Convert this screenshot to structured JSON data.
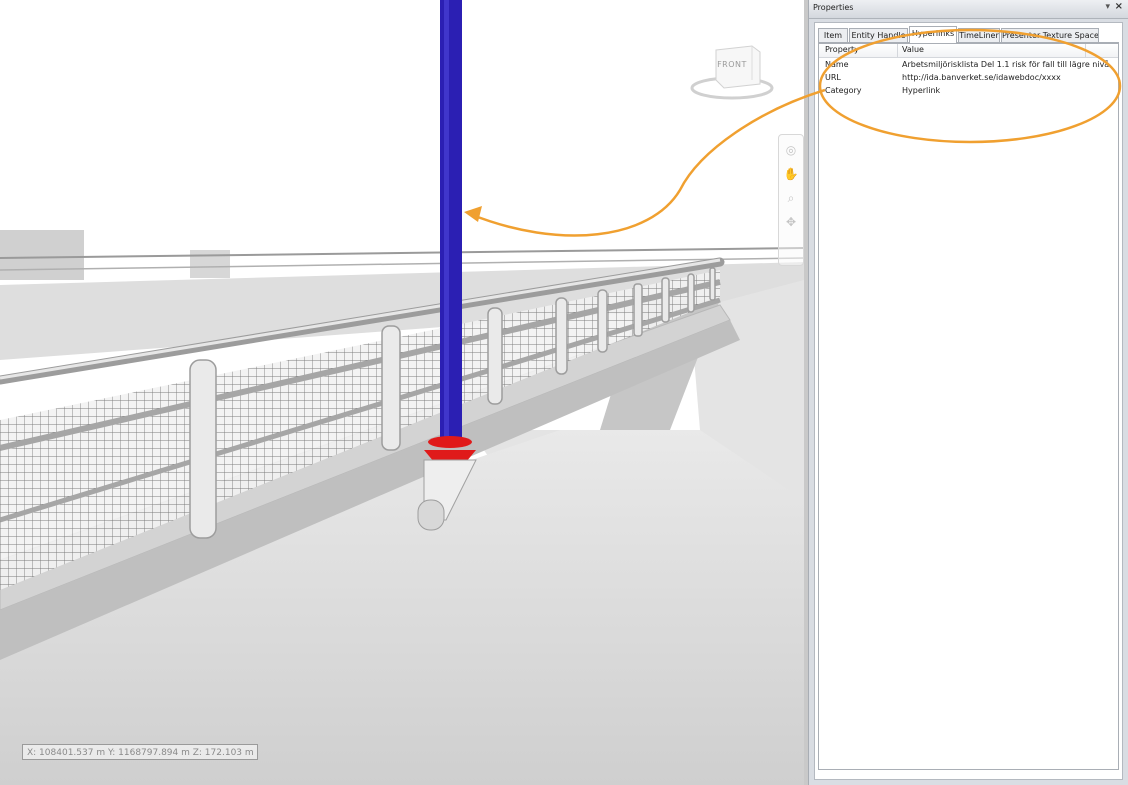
{
  "viewport": {
    "coordinates": "X: 108401.537 m  Y: 1168797.894 m  Z: 172.103 m",
    "viewcube_label": "FRONT",
    "nav_icons": [
      "orbit-icon",
      "pan-hand-icon",
      "zoom-icon",
      "walk-icon"
    ]
  },
  "panel": {
    "title": "Properties",
    "pin_icon": "pin-icon",
    "close_icon": "close-icon",
    "tabs": [
      {
        "label": "Item"
      },
      {
        "label": "Entity Handle"
      },
      {
        "label": "Hyperlinks"
      },
      {
        "label": "TimeLiner"
      },
      {
        "label": "Presenter Texture Space"
      }
    ],
    "active_tab": "Hyperlinks",
    "columns": [
      "Property",
      "Value"
    ],
    "rows": [
      {
        "property": "Name",
        "value": "Arbetsmiljörisklista Del 1.1 risk för fall till lägre nivå"
      },
      {
        "property": "URL",
        "value": "http://ida.banverket.se/idawebdoc/xxxx"
      },
      {
        "property": "Category",
        "value": "Hyperlink"
      }
    ]
  },
  "colors": {
    "pole": "#2b1fb3",
    "base": "#e01a1a",
    "annotation": "#f0a030"
  }
}
